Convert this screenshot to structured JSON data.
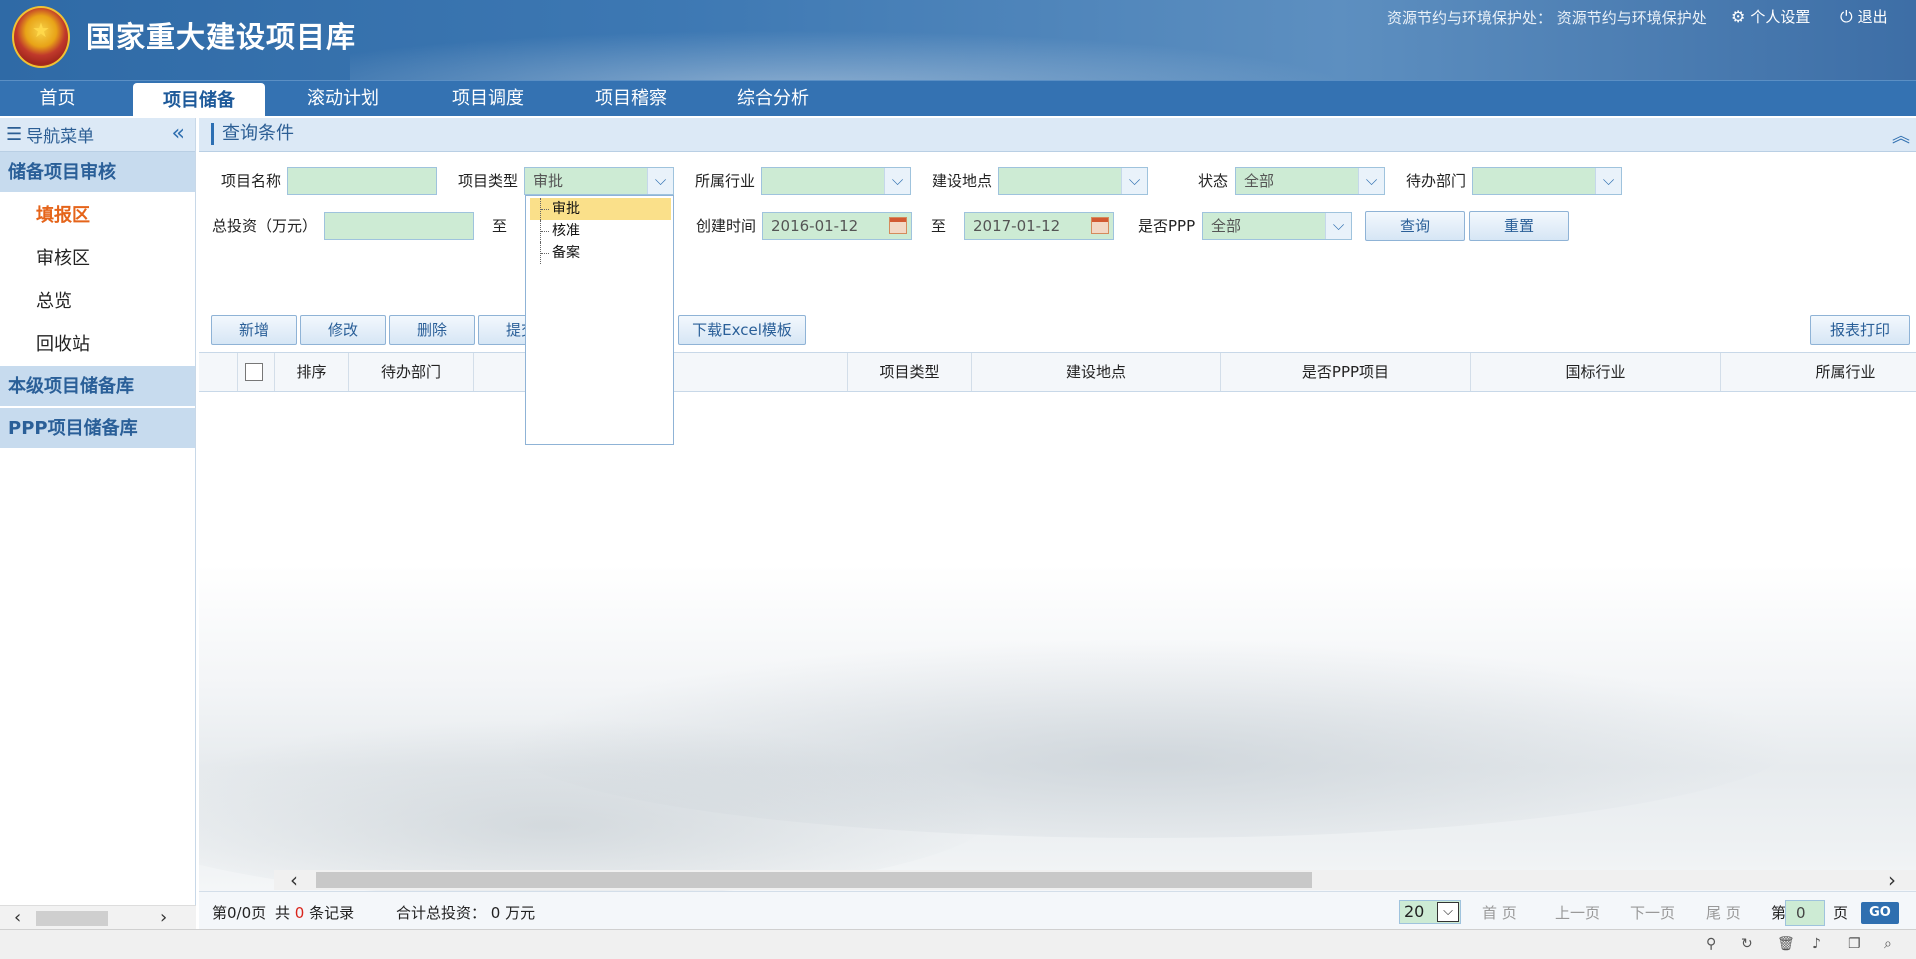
{
  "header": {
    "title": "国家重大建设项目库",
    "user_info": "资源节约与环境保护处： 资源节约与环境保护处",
    "settings_label": "个人设置",
    "logout_label": "退出"
  },
  "topnav": {
    "tabs": [
      {
        "label": "首页"
      },
      {
        "label": "项目储备"
      },
      {
        "label": "滚动计划"
      },
      {
        "label": "项目调度"
      },
      {
        "label": "项目稽察"
      },
      {
        "label": "综合分析"
      }
    ],
    "active": "项目储备"
  },
  "sidebar": {
    "title": "导航菜单",
    "collapse_icon": "«",
    "groups": [
      {
        "label": "储备项目审核"
      },
      {
        "label": "本级项目储备库"
      },
      {
        "label": "PPP项目储备库"
      }
    ],
    "items": [
      {
        "label": "填报区"
      },
      {
        "label": "审核区"
      },
      {
        "label": "总览"
      },
      {
        "label": "回收站"
      }
    ]
  },
  "query": {
    "title": "查询条件",
    "project_name_label": "项目名称",
    "project_name_value": "",
    "project_type_label": "项目类型",
    "project_type_value": "审批",
    "industry_label": "所属行业",
    "industry_value": "",
    "location_label": "建设地点",
    "location_value": "",
    "status_label": "状态",
    "status_value": "全部",
    "pending_dept_label": "待办部门",
    "pending_dept_value": "",
    "investment_label": "总投资（万元）",
    "investment_from": "",
    "to_label": "至",
    "created_label": "创建时间",
    "created_from": "2016-01-12",
    "created_to": "2017-01-12",
    "ppp_label": "是否PPP",
    "ppp_value": "全部",
    "search_button": "查询",
    "reset_button": "重置"
  },
  "project_type_dropdown": {
    "options": [
      {
        "label": "审批"
      },
      {
        "label": "核准"
      },
      {
        "label": "备案"
      }
    ],
    "highlighted": "审批"
  },
  "toolbar": {
    "add": "新增",
    "edit": "修改",
    "delete": "删除",
    "submit": "提交",
    "download_template": "下载Excel模板",
    "print_report": "报表打印"
  },
  "grid": {
    "columns": [
      {
        "label": "排序"
      },
      {
        "label": "待办部门"
      },
      {
        "label": "称"
      },
      {
        "label": "项目类型"
      },
      {
        "label": "建设地点"
      },
      {
        "label": "是否PPP项目"
      },
      {
        "label": "国标行业"
      },
      {
        "label": "所属行业"
      }
    ],
    "rows": []
  },
  "pager": {
    "page_info": "第0/0页",
    "total_prefix": "共",
    "total_count": "0",
    "total_suffix": "条记录",
    "total_investment": "合计总投资： 0 万元",
    "page_size": "20",
    "first": "首 页",
    "prev": "上一页",
    "next": "下一页",
    "last": "尾 页",
    "page_prefix": "第",
    "page_number": "0",
    "page_suffix": "页",
    "go": "GO"
  }
}
